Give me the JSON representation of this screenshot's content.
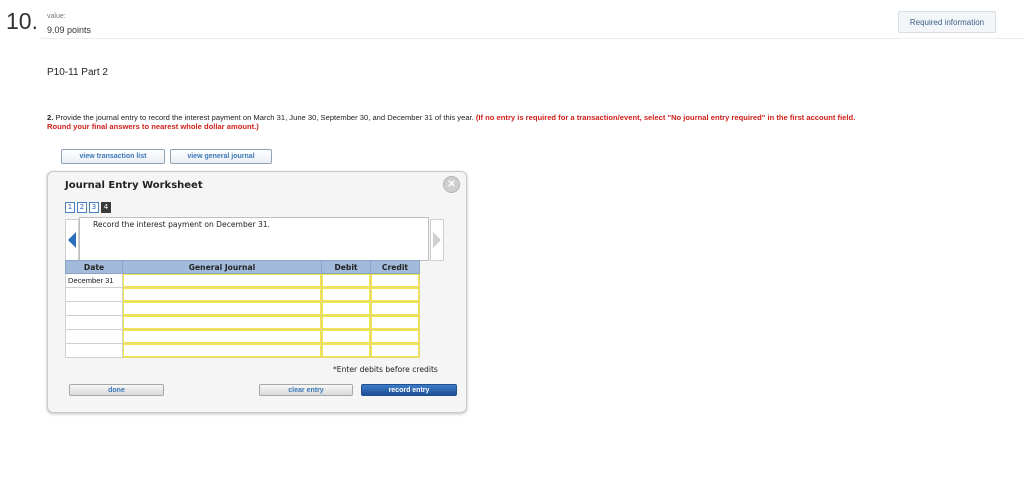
{
  "question": {
    "number": "10.",
    "value_label": "value:",
    "points": "9.09 points",
    "required_info_label": "Required information",
    "part_title": "P10-11 Part 2",
    "instruction_number": "2.",
    "instruction_text": " Provide the journal entry to record the interest payment on March 31, June 30, September 30, and December 31 of this year. ",
    "instruction_red": "(If no entry is required for a transaction/event, select \"No journal entry required\" in the first account field.",
    "instruction_red_line2": "Round your final answers to nearest whole dollar amount.)"
  },
  "top_buttons": {
    "transaction_list": "view transaction list",
    "general_journal": "view general journal"
  },
  "worksheet": {
    "title": "Journal Entry Worksheet",
    "close_glyph": "✕",
    "steps": [
      "1",
      "2",
      "3",
      "4"
    ],
    "active_step": "4",
    "prompt": "Record the interest payment on December 31.",
    "columns": {
      "date": "Date",
      "journal": "General Journal",
      "debit": "Debit",
      "credit": "Credit"
    },
    "rows": [
      {
        "date": "December 31"
      },
      {
        "date": ""
      },
      {
        "date": ""
      },
      {
        "date": ""
      },
      {
        "date": ""
      },
      {
        "date": ""
      }
    ],
    "note": "*Enter debits before credits",
    "done_label": "done",
    "clear_label": "clear entry",
    "record_label": "record entry"
  }
}
